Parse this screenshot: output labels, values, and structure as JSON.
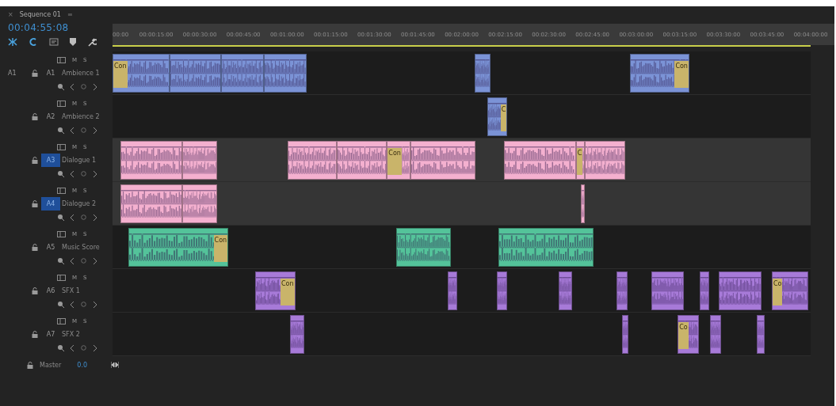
{
  "tab": {
    "close": "×",
    "title": "Sequence 01",
    "menu": "≡"
  },
  "timecode": "00:04:55:08",
  "ruler": [
    "00:00",
    "00:00:15:00",
    "00:00:30:00",
    "00:00:45:00",
    "00:01:00:00",
    "00:01:15:00",
    "00:01:30:00",
    "00:01:45:00",
    "00:02:00:00",
    "00:02:15:00",
    "00:02:30:00",
    "00:02:45:00",
    "00:03:00:00",
    "00:03:15:00",
    "00:03:30:00",
    "00:03:45:00",
    "00:04:00:00"
  ],
  "tracks": [
    {
      "source": "A1",
      "id": "A1",
      "name": "Ambience 1",
      "targeted": false,
      "color": "#7b93d6",
      "mute": "M",
      "solo": "S",
      "transitions": [
        "Con",
        "Con"
      ]
    },
    {
      "id": "A2",
      "name": "Ambience 2",
      "targeted": false,
      "color": "#7b93d6",
      "mute": "M",
      "solo": "S",
      "transitions": [
        "C"
      ]
    },
    {
      "id": "A3",
      "name": "Dialogue 1",
      "targeted": true,
      "color": "#f4b0cf",
      "mute": "M",
      "solo": "S",
      "transitions": [
        "Con",
        "C"
      ]
    },
    {
      "id": "A4",
      "name": "Dialogue 2",
      "targeted": true,
      "color": "#f4b0cf",
      "mute": "M",
      "solo": "S"
    },
    {
      "id": "A5",
      "name": "Music Score",
      "targeted": false,
      "color": "#54c39a",
      "mute": "M",
      "solo": "S",
      "transitions": [
        "Con"
      ]
    },
    {
      "id": "A6",
      "name": "SFX 1",
      "targeted": false,
      "color": "#a77ad8",
      "mute": "M",
      "solo": "S",
      "transitions": [
        "Con",
        "Co"
      ]
    },
    {
      "id": "A7",
      "name": "SFX 2",
      "targeted": false,
      "color": "#a77ad8",
      "mute": "M",
      "solo": "S",
      "transitions": [
        "Co"
      ]
    }
  ],
  "master": {
    "name": "Master",
    "value": "0.0"
  }
}
